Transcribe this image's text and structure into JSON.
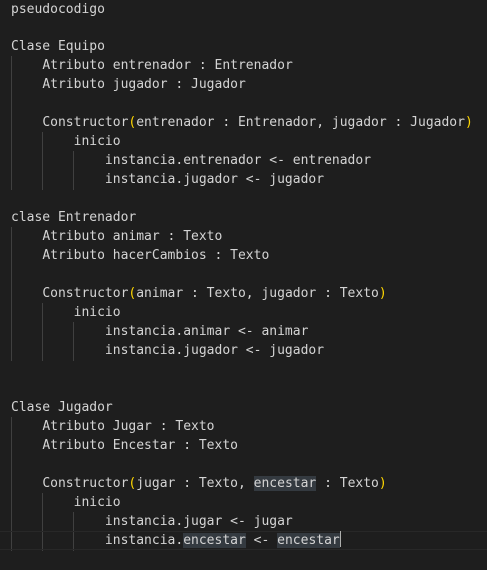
{
  "editor": {
    "title": "pseudocodigo",
    "equipo": {
      "header": "Clase Equipo",
      "attr1": "Atributo entrenador : Entrenador",
      "attr2": "Atributo jugador : Jugador",
      "ctor_name": "Constructor",
      "ctor_open": "(",
      "ctor_params": "entrenador : Entrenador, jugador : Jugador",
      "ctor_close": ")",
      "inicio": "inicio",
      "stmt1": "instancia.entrenador <- entrenador",
      "stmt2": "instancia.jugador <- jugador"
    },
    "entrenador": {
      "header": "clase Entrenador",
      "attr1": "Atributo animar : Texto",
      "attr2": "Atributo hacerCambios : Texto",
      "ctor_name": "Constructor",
      "ctor_open": "(",
      "ctor_params": "animar : Texto, jugador : Texto",
      "ctor_close": ")",
      "inicio": "inicio",
      "stmt1": "instancia.animar <- animar",
      "stmt2": "instancia.jugador <- jugador"
    },
    "jugador": {
      "header": "Clase Jugador",
      "attr1": "Atributo Jugar : Texto",
      "attr2": "Atributo Encestar : Texto",
      "ctor_name": "Constructor",
      "ctor_open": "(",
      "ctor_params_a": "jugar : Texto, ",
      "ctor_params_hl": "encestar",
      "ctor_params_b": " : Texto",
      "ctor_close": ")",
      "inicio": "inicio",
      "stmt1": "instancia.jugar <- jugar",
      "stmt2_a": "instancia.",
      "stmt2_hl1": "encestar",
      "stmt2_b": " <- ",
      "stmt2_hl2": "encestar"
    }
  },
  "colors": {
    "background": "#1e1e1e",
    "text": "#d4d4d4",
    "bracket": "#ffd700",
    "word_highlight": "#343a40",
    "indent_guide": "#404040"
  }
}
